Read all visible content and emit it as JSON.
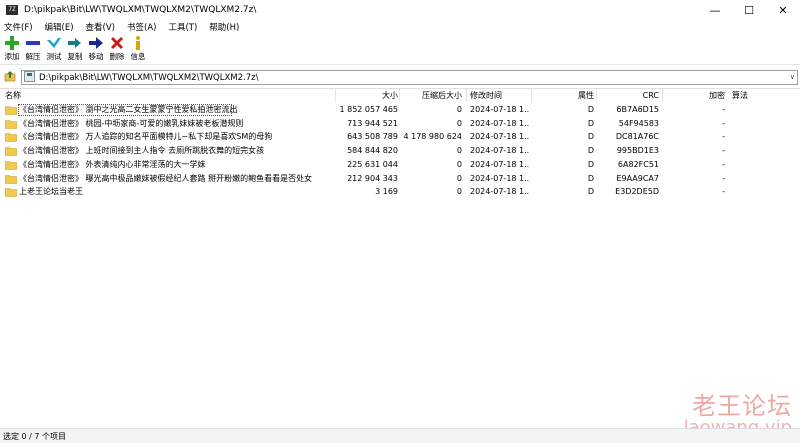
{
  "window": {
    "app_icon_text": "7Z",
    "title": "D:\\pikpak\\Bit\\LW\\TWQLXM\\TWQLXM2\\TWQLXM2.7z\\",
    "minimize_glyph": "—",
    "maximize_glyph": "☐",
    "close_glyph": "✕"
  },
  "menu": [
    "文件(F)",
    "编辑(E)",
    "查看(V)",
    "书签(A)",
    "工具(T)",
    "帮助(H)"
  ],
  "toolbar": [
    {
      "label": "添加",
      "icon": "plus-icon",
      "color": "#2aa52a"
    },
    {
      "label": "解压",
      "icon": "minus-icon",
      "color": "#2a3ab8"
    },
    {
      "label": "测试",
      "icon": "checkmark-icon",
      "color": "#1aa6c8"
    },
    {
      "label": "复制",
      "icon": "double-arrow-icon",
      "color": "#1a7a8a"
    },
    {
      "label": "移动",
      "icon": "arrow-right-icon",
      "color": "#1a2a8a"
    },
    {
      "label": "删除",
      "icon": "cross-icon",
      "color": "#d01818"
    },
    {
      "label": "信息",
      "icon": "info-icon",
      "color": "#d8a800"
    }
  ],
  "address": {
    "path": "D:\\pikpak\\Bit\\LW\\TWQLXM\\TWQLXM2\\TWQLXM2.7z\\",
    "dropdown_glyph": "∨"
  },
  "columns": {
    "name": "名称",
    "size": "大小",
    "packed": "压缩后大小",
    "modified": "修改时间",
    "attr": "属性",
    "crc": "CRC",
    "encrypted": "加密",
    "method": "算法"
  },
  "rows": [
    {
      "name": "《台湾情侣泄密》 瀏中之光高二女生蒙蒙宁性爱私拍泄密流出",
      "size": "1 852 057 465",
      "packed": "0",
      "modified": "2024-07-18 1...",
      "attr": "D",
      "crc": "6B7A6D15",
      "encrypted": "-"
    },
    {
      "name": "《台湾情侣泄密》 桃园-中坜家商-可爱的嫩乳妹妹被老板潜规则",
      "size": "713 944 521",
      "packed": "0",
      "modified": "2024-07-18 1...",
      "attr": "D",
      "crc": "54F94583",
      "encrypted": "-"
    },
    {
      "name": "《台湾情侣泄密》 万人追踪的知名平面模特儿∼私下却是喜欢SM的母狗",
      "size": "643 508 789",
      "packed": "4 178 980 624",
      "modified": "2024-07-18 1...",
      "attr": "D",
      "crc": "DC81A76C",
      "encrypted": "-"
    },
    {
      "name": "《台湾情侣泄密》 上班时间接到主人指令 去厕所跳脱衣舞的短完女孩",
      "size": "584 844 820",
      "packed": "0",
      "modified": "2024-07-18 1...",
      "attr": "D",
      "crc": "995BD1E3",
      "encrypted": "-"
    },
    {
      "name": "《台湾情侣泄密》 外表清纯内心非常淫荡的大一学妹",
      "size": "225 631 044",
      "packed": "0",
      "modified": "2024-07-18 1...",
      "attr": "D",
      "crc": "6A82FC51",
      "encrypted": "-"
    },
    {
      "name": "《台湾情侣泄密》 曝光高中极品嫩妹被假经纪人套路 掰开粉嫩的鲍鱼看看是否处女",
      "size": "212 904 343",
      "packed": "0",
      "modified": "2024-07-18 1...",
      "attr": "D",
      "crc": "E9AA9CA7",
      "encrypted": "-"
    },
    {
      "name": "上老王论坛当老王",
      "size": "3 169",
      "packed": "0",
      "modified": "2024-07-18 1...",
      "attr": "D",
      "crc": "E3D2DE5D",
      "encrypted": "-"
    }
  ],
  "watermark": {
    "cn": "老王论坛",
    "en": "laowang.vip"
  },
  "status": "选定 0 / 7 个项目"
}
